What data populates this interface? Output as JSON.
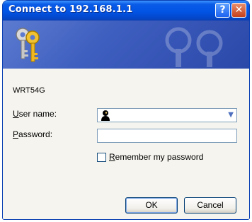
{
  "dialog": {
    "title": "Connect to 192.168.1.1",
    "help_glyph": "?",
    "close_glyph": "✕",
    "banner_icon": "keys-icon",
    "device_name": "WRT54G",
    "username": {
      "label_access": "U",
      "label_rest": "ser name:",
      "value": "",
      "icon": "user-icon"
    },
    "password": {
      "label_access": "P",
      "label_rest": "assword:",
      "value": ""
    },
    "remember": {
      "label_access": "R",
      "label_rest": "emember my password",
      "checked": false
    },
    "ok_label": "OK",
    "cancel_label": "Cancel"
  }
}
